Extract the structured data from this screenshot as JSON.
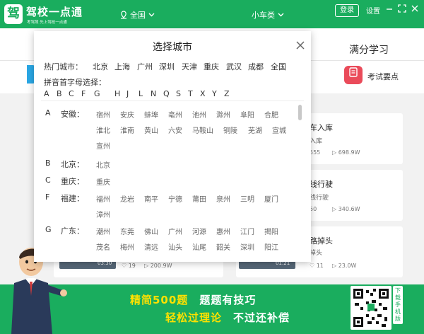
{
  "app": {
    "logo_char": "驾",
    "name": "驾校一点通",
    "slogan": "考驾照 先上驾校一点通"
  },
  "header": {
    "location": "全国",
    "car_type": "小车类",
    "login_label": "登录",
    "settings_label": "设置"
  },
  "background": {
    "tab_full_study": "满分学习",
    "exam_points": "考试要点",
    "cards": [
      {
        "title": "车入库",
        "sub": "入库",
        "stat1": "555",
        "stat2": "698.9W"
      },
      {
        "title": "线行驶",
        "sub": "线行驶",
        "stat1": "50",
        "stat2": "340.6W"
      },
      {
        "title": "路掉头",
        "sub": "掉头",
        "stat1": "11",
        "stat2": "23.0W"
      }
    ],
    "left_card": {
      "time": "03:30",
      "stat1": "19",
      "stat2": "200.9W"
    },
    "left_card2_time": "01:21"
  },
  "banner": {
    "line1_a": "精简500题",
    "line1_b": "题题有技巧",
    "line2_a": "轻松过理论",
    "line2_b": "不过还补偿",
    "qr_label": "下载手机版"
  },
  "modal": {
    "title": "选择城市",
    "hot_label": "热门城市：",
    "hot_cities": [
      "北京",
      "上海",
      "广州",
      "深圳",
      "天津",
      "重庆",
      "武汉",
      "成都",
      "全国"
    ],
    "pinyin_label": "拼音首字母选择：",
    "letters": [
      "A",
      "B",
      "C",
      "F",
      "G",
      "H",
      "J",
      "L",
      "N",
      "Q",
      "S",
      "T",
      "X",
      "Y",
      "Z"
    ],
    "provinces": [
      {
        "letter": "A",
        "name": "安徽：",
        "rows": [
          [
            "宿州",
            "安庆",
            "蚌埠",
            "亳州",
            "池州",
            "滁州",
            "阜阳",
            "合肥"
          ],
          [
            "淮北",
            "淮南",
            "黄山",
            "六安",
            "马鞍山",
            "铜陵",
            "芜湖",
            "宣城"
          ],
          [
            "宣州"
          ]
        ]
      },
      {
        "letter": "B",
        "name": "北京：",
        "rows": [
          [
            "北京"
          ]
        ]
      },
      {
        "letter": "C",
        "name": "重庆：",
        "rows": [
          [
            "重庆"
          ]
        ]
      },
      {
        "letter": "F",
        "name": "福建：",
        "rows": [
          [
            "福州",
            "龙岩",
            "南平",
            "宁德",
            "莆田",
            "泉州",
            "三明",
            "厦门"
          ],
          [
            "漳州"
          ]
        ]
      },
      {
        "letter": "G",
        "name": "广东：",
        "rows": [
          [
            "潮州",
            "东莞",
            "佛山",
            "广州",
            "河源",
            "惠州",
            "江门",
            "揭阳"
          ],
          [
            "茂名",
            "梅州",
            "清远",
            "汕头",
            "汕尾",
            "韶关",
            "深圳",
            "阳江"
          ]
        ]
      }
    ]
  }
}
